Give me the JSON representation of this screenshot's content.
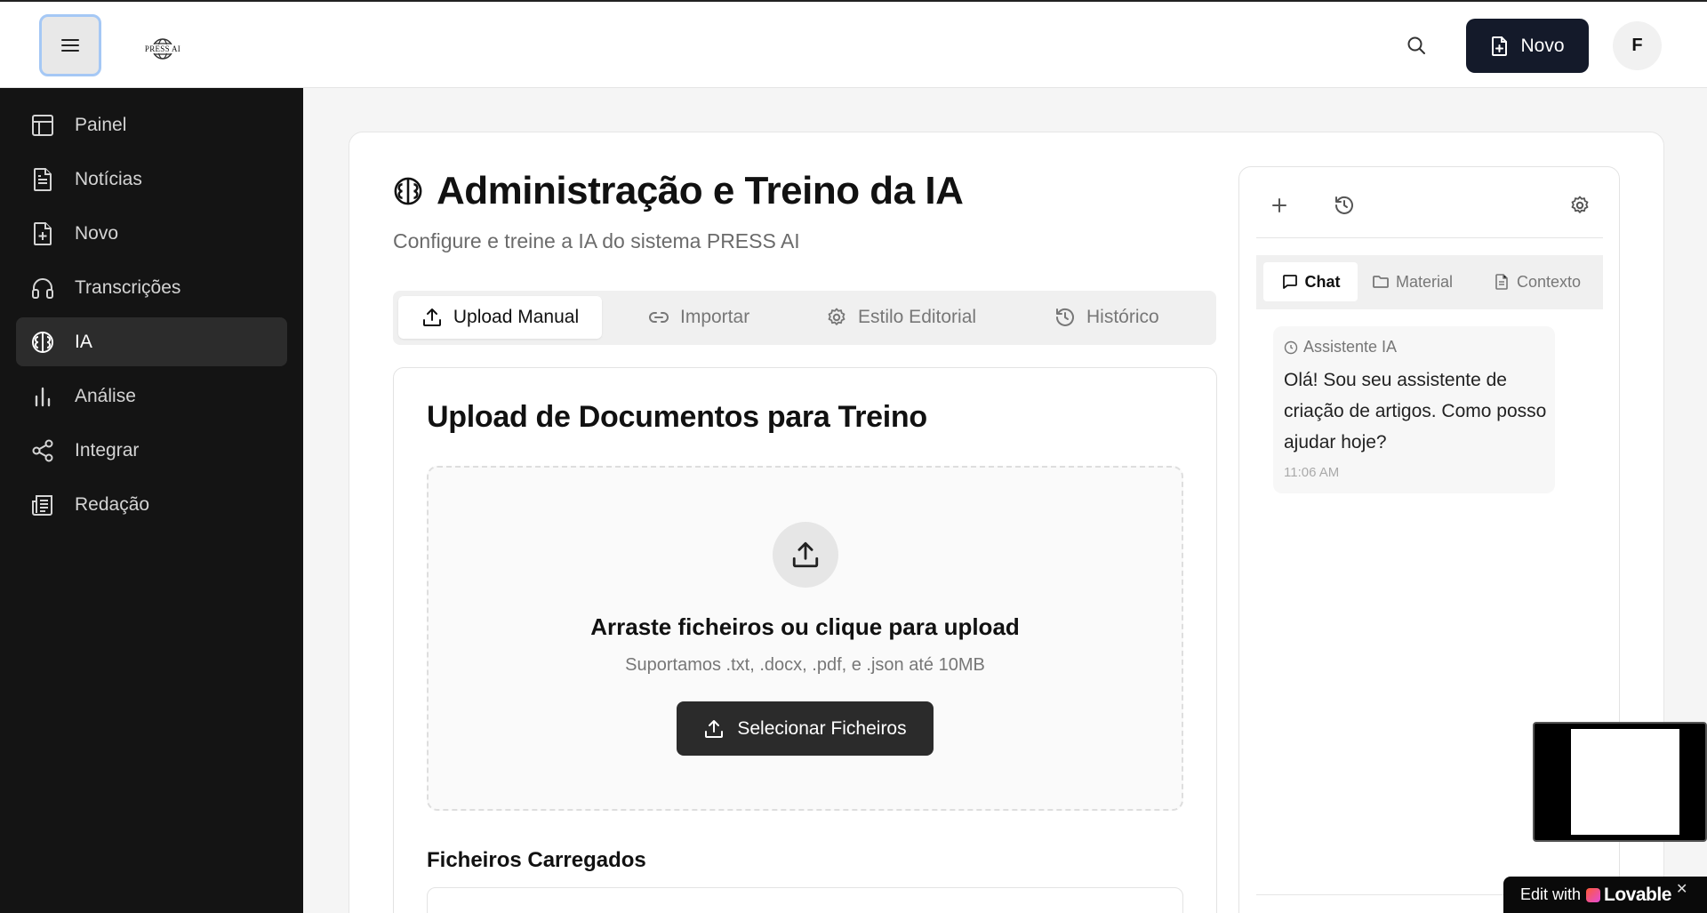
{
  "topbar": {
    "logo_text": "PRESS AI",
    "new_label": "Novo",
    "avatar_initial": "F",
    "icons": [
      "menu-icon",
      "search-icon",
      "file-plus-icon"
    ]
  },
  "sidebar": {
    "items": [
      {
        "label": "Painel",
        "icon": "layout-icon",
        "active": false
      },
      {
        "label": "Notícias",
        "icon": "file-text-icon",
        "active": false
      },
      {
        "label": "Novo",
        "icon": "file-plus-icon",
        "active": false
      },
      {
        "label": "Transcrições",
        "icon": "headphones-icon",
        "active": false
      },
      {
        "label": "IA",
        "icon": "brain-icon",
        "active": true
      },
      {
        "label": "Análise",
        "icon": "bar-chart-icon",
        "active": false
      },
      {
        "label": "Integrar",
        "icon": "share-icon",
        "active": false
      },
      {
        "label": "Redação",
        "icon": "newspaper-icon",
        "active": false
      }
    ]
  },
  "page": {
    "title": "Administração e Treino da IA",
    "subtitle": "Configure e treine a IA do sistema PRESS AI",
    "tabs": [
      {
        "label": "Upload Manual",
        "icon": "upload-icon",
        "active": true
      },
      {
        "label": "Importar",
        "icon": "link-icon",
        "active": false
      },
      {
        "label": "Estilo Editorial",
        "icon": "gear-icon",
        "active": false
      },
      {
        "label": "Histórico",
        "icon": "history-icon",
        "active": false
      }
    ]
  },
  "upload": {
    "title": "Upload de Documentos para Treino",
    "drop_title": "Arraste ficheiros ou clique para upload",
    "drop_subtitle": "Suportamos .txt, .docx, .pdf, e .json até 10MB",
    "select_button": "Selecionar Ficheiros",
    "loaded_title": "Ficheiros Carregados"
  },
  "chat": {
    "tabs": [
      {
        "label": "Chat",
        "icon": "message-icon",
        "active": true
      },
      {
        "label": "Material",
        "icon": "folder-icon",
        "active": false
      },
      {
        "label": "Contexto",
        "icon": "file-text-icon",
        "active": false
      }
    ],
    "message": {
      "sender": "Assistente IA",
      "text": "Olá! Sou seu assistente de criação de artigos. Como posso ajudar hoje?",
      "time": "11:06 AM"
    }
  },
  "badge": {
    "prefix": "Edit with",
    "brand": "Lovable",
    "close": "✕"
  },
  "colors": {
    "sidebar_bg": "#141414",
    "primary_dark": "#141a2a",
    "button_dark": "#2b2b2b"
  }
}
